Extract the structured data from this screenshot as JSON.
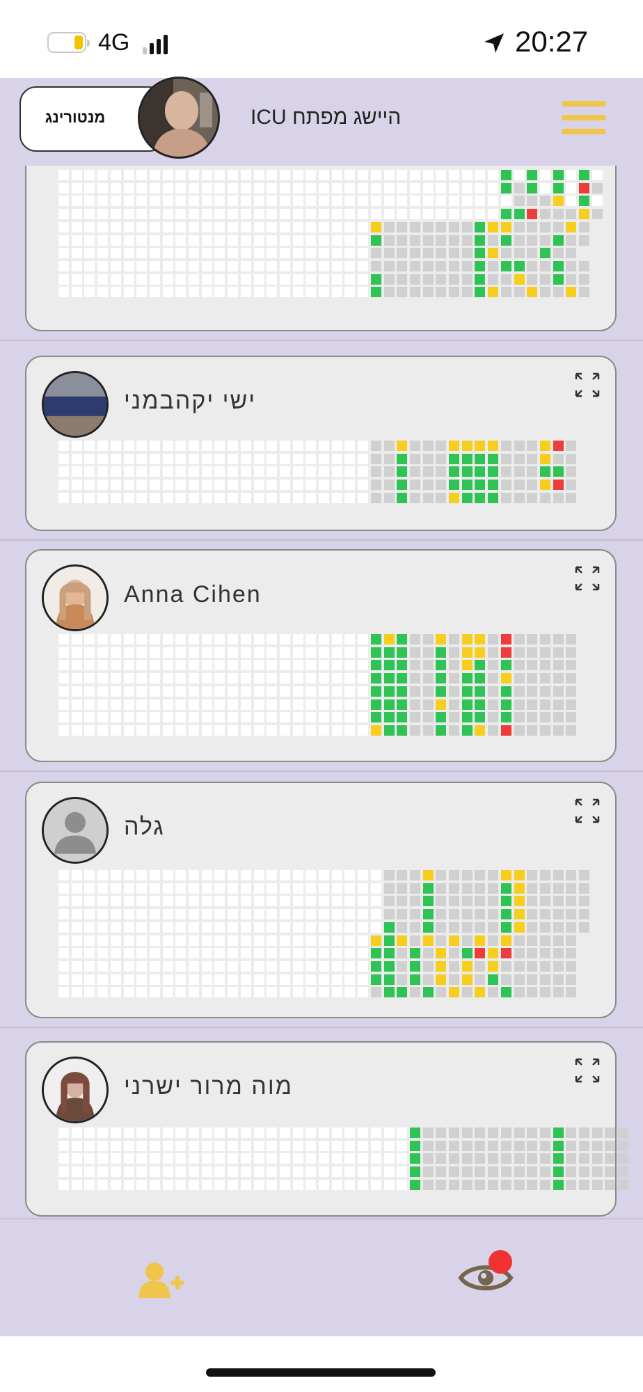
{
  "status_bar": {
    "network": "4G",
    "time": "20:27"
  },
  "header": {
    "mentoring_label": "מנטורינג",
    "title": "ICU היישג מפתח"
  },
  "colors": {
    "background": "#d8d3e8",
    "card": "#ececec",
    "accent": "#efc64b",
    "cell_empty": "#ffffff",
    "cell_gray": "#d0d0d0",
    "cell_green": "#2fc254",
    "cell_yellow": "#f7cd1e",
    "cell_red": "#ee3b3b",
    "notification": "#f03232"
  },
  "cards": [
    {
      "name": "",
      "expand_icon": "expand-icon",
      "rows": [
        "..................................GWGWGWGW",
        "..................................GXGWGWRX",
        "..................................WXXXYWGW",
        "..................................GGRXXXYX",
        "........................YXXXXXXXGYYXXXXYX",
        "........................GXXXXXXXGXGXXXGXX",
        "........................XXXXXXXXGYXXXGXX",
        "........................XXXXXXXXGXGGXXGXX",
        "........................GXXXXXXXGXXYXXGXX",
        "........................GXXXXXXXGYXXYXXYX"
      ]
    },
    {
      "name": "ישי יקהבמני",
      "expand_icon": "expand-icon",
      "rows": [
        "........................XXYXXXYYYYXXXYRX",
        "........................XXGXXXGGGGXXXYXX",
        "........................XXGXXXGGGGXXXGGX",
        "........................XXGXXXGGGGXXXYRX",
        "........................XXGXXXYGGGXXXXXX"
      ]
    },
    {
      "name": "Anna Cihen",
      "expand_icon": "expand-icon",
      "rows": [
        "........................GYGXXYXYYXRXXXXX",
        "........................GGGXXGXYYXRXXXXX",
        "........................GGGXXGXYGXGXXXXX",
        "........................GGGXXGXGGXYXXXXX",
        "........................GGGXXGXGGXGXXXXX",
        "........................GGGXXYXGGXGXXXXX",
        "........................GGGXXGXGGXGXXXXX",
        "........................YGGXXGXGYXRXXXXX"
      ]
    },
    {
      "name": "גלה",
      "expand_icon": "expand-icon",
      "rows": [
        ".........................XXXYXXXXXYYXXXXX",
        ".........................XXXGXXXXXGYXXXXX",
        ".........................XXXGXXXXXGYXXXXX",
        ".........................XXXGXXXXXGYXXXXX",
        ".........................GXXGXXXXXGYXXXXX",
        "........................YGYXYXYXYXYXXXXX",
        "........................GGXGXYXGRYRXXXXX",
        "........................GGXGXYXYXYXXXXXX",
        "........................GGXGXYXYXGXXXXXX",
        "........................XGGXGXYXYXGXXXXX"
      ]
    },
    {
      "name": "מוה מרור ישרני",
      "expand_icon": "expand-icon",
      "rows": [
        "...........................GXXXXXXXXXXGXXXXX",
        "...........................GXXXXXXXXXXGXXXXX",
        "...........................GXXXXXXXXXXGXXXXX",
        "...........................GXXXXXXXXXXGXXXXX",
        "...........................GXXXXXXXXXXGXXXXX"
      ]
    }
  ],
  "bottom_nav": {
    "add_user_icon": "add-user-icon",
    "eye_icon": "eye-icon",
    "notification_dot": "notification-dot"
  }
}
